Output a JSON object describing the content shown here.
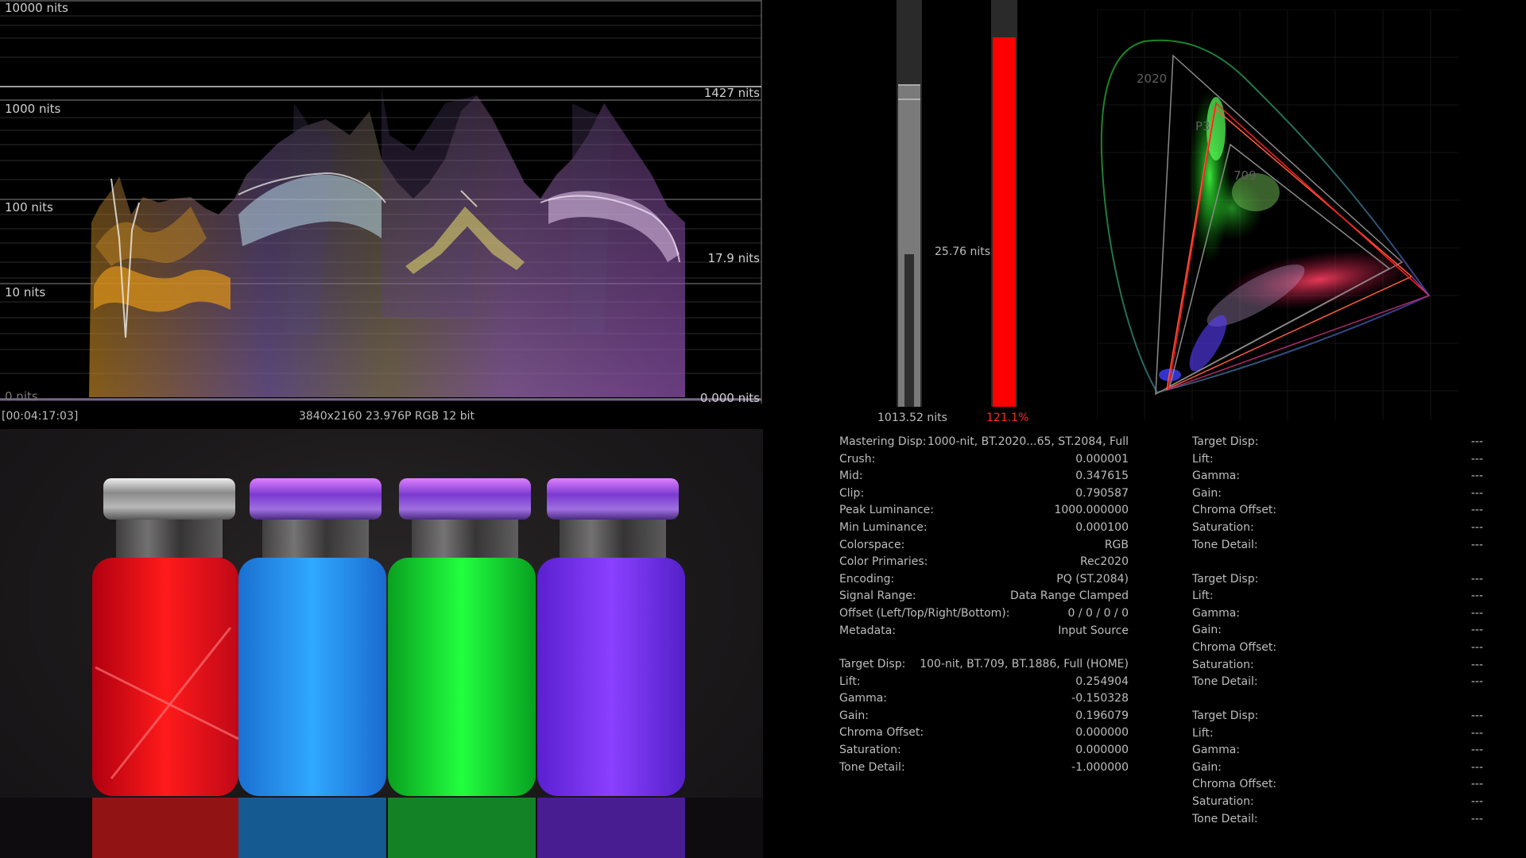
{
  "waveform": {
    "scale_labels": [
      "10000 nits",
      "1000 nits",
      "100 nits",
      "10 nits",
      "0 nits"
    ],
    "max_marker": "1427 nits",
    "avg_marker": "17.9 nits",
    "min_marker": "0.000 nits",
    "timecode": "[00:04:17:03]",
    "format": "3840x2160 23.976P RGB 12 bit"
  },
  "meters": {
    "max_luminance": "1013.52 nits",
    "avg_luminance": "25.76 nits",
    "gamut_percent": "121.1%",
    "gamut_color": "#ff0000"
  },
  "cie": {
    "labels": [
      "2020",
      "P3",
      "709"
    ],
    "colors": {
      "bt2020": "#8a8a8a",
      "p3": "#ff5a3c",
      "rec709": "#8a8a8a",
      "source": "#ff2020"
    }
  },
  "preview": {
    "vial_colors": [
      "#ff1a1a",
      "#1e9bff",
      "#18e43a",
      "#7a2cff"
    ]
  },
  "mastering": [
    {
      "k": "Mastering Disp:",
      "v": "1000-nit, BT.2020...65, ST.2084, Full"
    },
    {
      "k": "Crush:",
      "v": "0.000001"
    },
    {
      "k": "Mid:",
      "v": "0.347615"
    },
    {
      "k": "Clip:",
      "v": "0.790587"
    },
    {
      "k": "Peak Luminance:",
      "v": "1000.000000"
    },
    {
      "k": "Min Luminance:",
      "v": "0.000100"
    },
    {
      "k": "Colorspace:",
      "v": "RGB"
    },
    {
      "k": "Color Primaries:",
      "v": "Rec2020"
    },
    {
      "k": "Encoding:",
      "v": "PQ (ST.2084)"
    },
    {
      "k": "Signal Range:",
      "v": "Data Range Clamped"
    },
    {
      "k": "Offset (Left/Top/Right/Bottom):",
      "v": "0 / 0 / 0 / 0"
    },
    {
      "k": "Metadata:",
      "v": "Input Source"
    }
  ],
  "target_main": [
    {
      "k": "Target Disp:",
      "v": "100-nit, BT.709, BT.1886, Full (HOME)"
    },
    {
      "k": "Lift:",
      "v": "0.254904"
    },
    {
      "k": "Gamma:",
      "v": "-0.150328"
    },
    {
      "k": "Gain:",
      "v": "0.196079"
    },
    {
      "k": "Chroma Offset:",
      "v": "0.000000"
    },
    {
      "k": "Saturation:",
      "v": "0.000000"
    },
    {
      "k": "Tone Detail:",
      "v": "-1.000000"
    }
  ],
  "target_blocks": [
    [
      {
        "k": "Target Disp:",
        "v": "---"
      },
      {
        "k": "Lift:",
        "v": "---"
      },
      {
        "k": "Gamma:",
        "v": "---"
      },
      {
        "k": "Gain:",
        "v": "---"
      },
      {
        "k": "Chroma Offset:",
        "v": "---"
      },
      {
        "k": "Saturation:",
        "v": "---"
      },
      {
        "k": "Tone Detail:",
        "v": "---"
      }
    ],
    [
      {
        "k": "Target Disp:",
        "v": "---"
      },
      {
        "k": "Lift:",
        "v": "---"
      },
      {
        "k": "Gamma:",
        "v": "---"
      },
      {
        "k": "Gain:",
        "v": "---"
      },
      {
        "k": "Chroma Offset:",
        "v": "---"
      },
      {
        "k": "Saturation:",
        "v": "---"
      },
      {
        "k": "Tone Detail:",
        "v": "---"
      }
    ],
    [
      {
        "k": "Target Disp:",
        "v": "---"
      },
      {
        "k": "Lift:",
        "v": "---"
      },
      {
        "k": "Gamma:",
        "v": "---"
      },
      {
        "k": "Gain:",
        "v": "---"
      },
      {
        "k": "Chroma Offset:",
        "v": "---"
      },
      {
        "k": "Saturation:",
        "v": "---"
      },
      {
        "k": "Tone Detail:",
        "v": "---"
      }
    ]
  ]
}
